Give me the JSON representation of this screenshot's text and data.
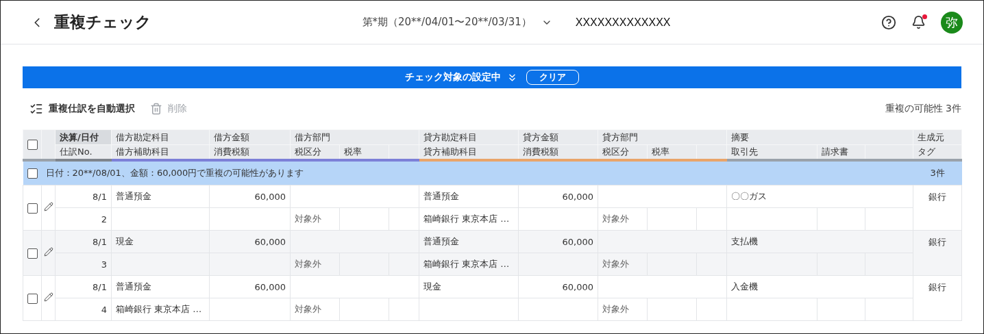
{
  "header": {
    "title": "重複チェック",
    "period": "第*期（20**/04/01〜20**/03/31）",
    "company": "XXXXXXXXXXXXX",
    "notification_unread": true,
    "avatar": "弥"
  },
  "banner": {
    "label": "チェック対象の設定中",
    "clear_button": "クリア"
  },
  "toolbar": {
    "auto_select": "重複仕訳を自動選択",
    "delete": {
      "label": "削除",
      "disabled": true
    },
    "summary": "重複の可能性 3件"
  },
  "table": {
    "select_all_checked": false,
    "header_top": [
      "決算/日付",
      "借方勘定科目",
      "借方金額",
      "借方部門",
      "貸方勘定科目",
      "貸方金額",
      "貸方部門",
      "摘要",
      "生成元"
    ],
    "header_bottom": [
      "仕訳No.",
      "借方補助科目",
      "消費税額",
      "税区分",
      "税率",
      "貸方補助科目",
      "消費税額",
      "税区分",
      "税率",
      "取引先",
      "請求書",
      "タグ"
    ],
    "groups": [
      {
        "checked": false,
        "message": "日付：20**/08/01、金額：60,000円で重複の可能性があります",
        "count": "3件",
        "entries": [
          {
            "checked": false,
            "date": "8/1",
            "no": "2",
            "debit_account": "普通預金",
            "debit_amount": "60,000",
            "debit_tax_category": "対象外",
            "credit_account": "普通預金",
            "credit_sub": "箱崎銀行 東京本店 …",
            "credit_amount": "60,000",
            "credit_tax_category": "対象外",
            "description": "〇〇ガス",
            "source": "銀行"
          },
          {
            "checked": false,
            "date": "8/1",
            "no": "3",
            "debit_account": "現金",
            "debit_amount": "60,000",
            "debit_tax_category": "対象外",
            "credit_account": "普通預金",
            "credit_sub": "箱崎銀行 東京本店 …",
            "credit_amount": "60,000",
            "credit_tax_category": "対象外",
            "description": "支払機",
            "source": "銀行"
          },
          {
            "checked": false,
            "date": "8/1",
            "no": "4",
            "debit_account": "普通預金",
            "debit_sub": "箱崎銀行 東京本店 …",
            "debit_amount": "60,000",
            "debit_tax_category": "対象外",
            "credit_account": "現金",
            "credit_amount": "60,000",
            "credit_tax_category": "対象外",
            "description": "入金機",
            "source": "銀行"
          }
        ]
      }
    ]
  }
}
